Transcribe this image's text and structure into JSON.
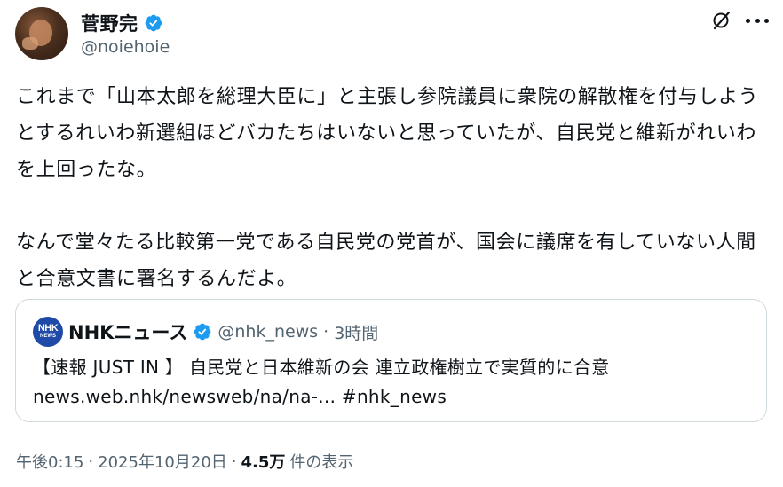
{
  "author": {
    "display_name": "菅野完",
    "handle": "@noiehoie",
    "verified": true
  },
  "tweet": {
    "text": "これまで「山本太郎を総理大臣に」と主張し参院議員に衆院の解散権を付与しようとするれいわ新選組ほどバカたちはいないと思っていたが、自民党と維新がれいわを上回ったな。\n\nなんで堂々たる比較第一党である自民党の党首が、国会に議席を有していない人間と合意文書に署名するんだよ。"
  },
  "quote": {
    "logo_text_1": "NHK",
    "logo_text_2": "NEWS",
    "display_name": "NHKニュース",
    "handle": "@nhk_news",
    "separator": "·",
    "time": "3時間",
    "line1": "【速報 JUST IN 】 自民党と日本維新の会 連立政権樹立で実質的に合意",
    "line2": "news.web.nhk/newsweb/na/na-... #nhk_news"
  },
  "meta": {
    "time": "午後0:15",
    "sep1": "·",
    "date": "2025年10月20日",
    "sep2": "·",
    "views_count": "4.5万",
    "views_label": "件の表示"
  },
  "colors": {
    "verified_blue": "#1d9bf0",
    "secondary_text": "#536471",
    "border": "#cfd9de",
    "nhk_blue": "#1f4aa8"
  },
  "icons": {
    "grok": "grok-icon",
    "more": "more-icon"
  }
}
